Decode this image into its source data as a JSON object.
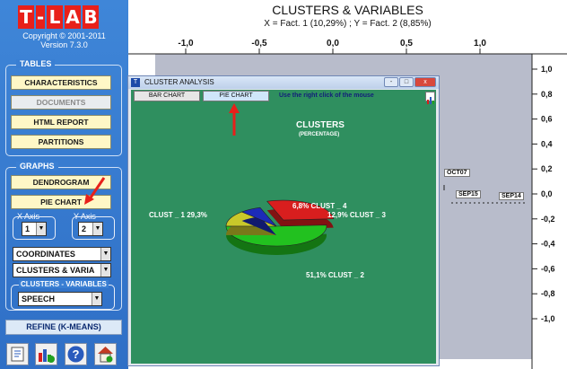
{
  "app": {
    "logo_letters": [
      "T",
      "-",
      "L",
      "A",
      "B"
    ],
    "copyright": "Copyright © 2001-2011",
    "version": "Version 7.3.0"
  },
  "sidebar": {
    "tables_title": "TABLES",
    "tables": [
      "CHARACTERISTICS",
      "DOCUMENTS",
      "HTML REPORT",
      "PARTITIONS"
    ],
    "graphs_title": "GRAPHS",
    "graphs": [
      "DENDROGRAM",
      "PIE CHART"
    ],
    "x_axis_label": "X Axis",
    "y_axis_label": "Y Axis",
    "x_axis_value": "1",
    "y_axis_value": "2",
    "coords_select": "COORDINATES",
    "view_select": "CLUSTERS & VARIA",
    "cv_title": "CLUSTERS - VARIABLES",
    "cv_select": "SPEECH",
    "refine_label": "REFINE (K-MEANS)",
    "tools": [
      "help-icon",
      "chart-check-icon",
      "question-icon",
      "home-icon"
    ]
  },
  "plot": {
    "title": "CLUSTERS & VARIABLES",
    "subtitle": "X = Fact. 1 (10,29%) ; Y = Fact. 2 (8,85%)",
    "x_ticks": [
      "-1,0",
      "-0,5",
      "0,0",
      "0,5",
      "1,0"
    ],
    "y_ticks": [
      "1,0",
      "0,8",
      "0,6",
      "0,4",
      "0,2",
      "0,0",
      "-0,2",
      "-0,4",
      "-0,6",
      "-0,8",
      "-1,0"
    ],
    "labels": [
      "OCT07",
      "SEP15",
      "SEP14"
    ],
    "colors": {
      "band": "#b8bccb",
      "axis": "#222222"
    }
  },
  "window": {
    "title": "CLUSTER ANALYSIS",
    "controls": [
      "-",
      "□",
      "x"
    ],
    "tab_bar": "BAR CHART",
    "tab_pie": "PIE CHART",
    "hint": "Use the right click of the mouse",
    "chart_title": "CLUSTERS",
    "chart_subtitle": "(PERCENTAGE)"
  },
  "chart_data": {
    "type": "pie",
    "title": "CLUSTERS",
    "subtitle": "(PERCENTAGE)",
    "slices": [
      {
        "name": "CLUST _ 1",
        "value": 29.3,
        "display": "29,3%",
        "color": "#d81e1e"
      },
      {
        "name": "CLUST _ 2",
        "value": 51.1,
        "display": "51,1%",
        "color": "#22c11f"
      },
      {
        "name": "CLUST _ 3",
        "value": 12.9,
        "display": "12,9%",
        "color": "#c9c82a"
      },
      {
        "name": "CLUST _ 4",
        "value": 6.8,
        "display": "6,8%",
        "color": "#1c2bb8"
      }
    ],
    "labels": [
      "CLUST _ 1  29,3%",
      "51,1%  CLUST _ 2",
      "12,9%  CLUST _ 3",
      "6,8%  CLUST _ 4"
    ]
  }
}
